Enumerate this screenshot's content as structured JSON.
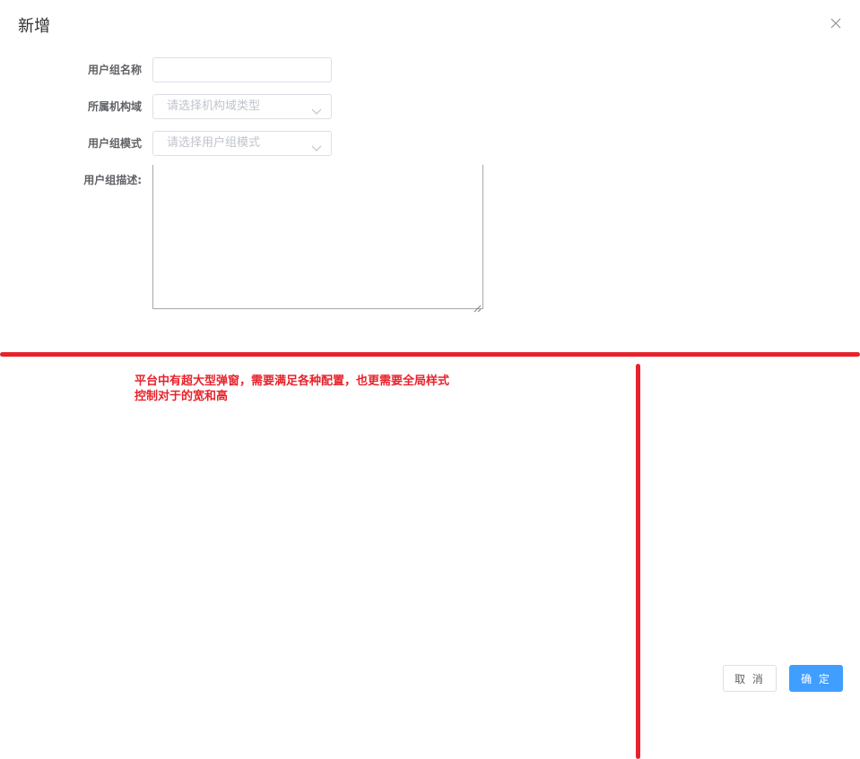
{
  "dialog": {
    "title": "新增",
    "close_icon": "close-icon"
  },
  "form": {
    "group_name": {
      "label": "用户组名称",
      "value": ""
    },
    "org_domain": {
      "label": "所属机构域",
      "placeholder": "请选择机构域类型",
      "icon": "chevron-down-icon"
    },
    "group_mode": {
      "label": "用户组模式",
      "placeholder": "请选择用户组模式",
      "icon": "chevron-down-icon"
    },
    "description": {
      "label": "用户组描述:",
      "value": ""
    }
  },
  "annotation": {
    "line1": "平台中有超大型弹窗，需要满足各种配置，也更需要全局样式",
    "line2": "控制对于的宽和高",
    "color": "#e8222b"
  },
  "footer": {
    "cancel_label": "取 消",
    "confirm_label": "确 定",
    "confirm_color": "#409eff"
  }
}
